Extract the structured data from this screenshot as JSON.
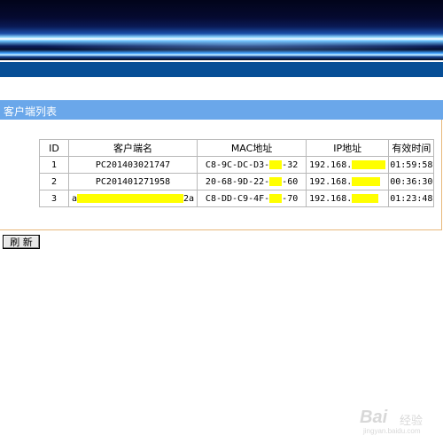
{
  "panel": {
    "title": "客户端列表"
  },
  "table": {
    "headers": [
      "ID",
      "客户端名",
      "MAC地址",
      "IP地址",
      "有效时间"
    ],
    "rows": [
      {
        "id": "1",
        "name": "PC201403021747",
        "mac_prefix": "C8-9C-DC-D3-",
        "mac_suffix": "-32",
        "ip_prefix": "192.168.",
        "time": "01:59:58"
      },
      {
        "id": "2",
        "name": "PC201401271958",
        "mac_prefix": "20-68-9D-22-",
        "mac_suffix": "-60",
        "ip_prefix": "192.168.",
        "time": "00:36:30"
      },
      {
        "id": "3",
        "name_prefix": "a",
        "name_suffix": "2a",
        "mac_prefix": "C8-DD-C9-4F-",
        "mac_suffix": "-70",
        "ip_prefix": "192.168.",
        "time": "01:23:48"
      }
    ]
  },
  "buttons": {
    "refresh": "刷 新"
  },
  "watermark": {
    "brand": "Bai",
    "jingyan": "经验",
    "url": "jingyan.baidu.com"
  },
  "colors": {
    "title_bar": "#6aa7ea",
    "redaction": "#ffff00",
    "top_bar": "#064e96"
  }
}
